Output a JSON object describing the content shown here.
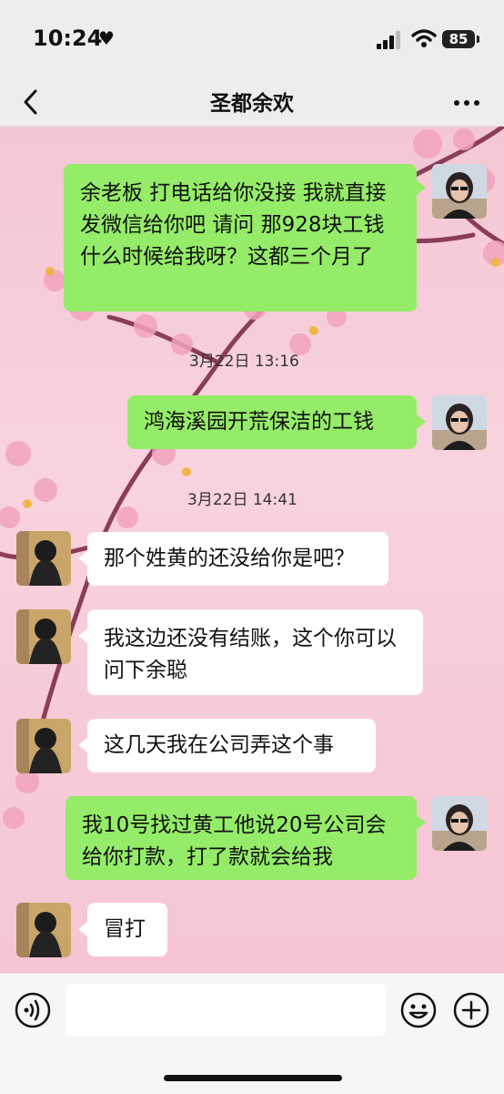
{
  "status_bar": {
    "time": "10:24",
    "battery": "85"
  },
  "chat": {
    "title": "圣都余欢"
  },
  "messages": [
    {
      "sender": "me",
      "text": "余老板 打电话给你没接 我就直接发微信给你吧 请问 那928块工钱什么时候给我呀？这都三个月了"
    },
    {
      "type": "timestamp",
      "text": "3月22日 13:16"
    },
    {
      "sender": "me",
      "text": "鸿海溪园开荒保洁的工钱"
    },
    {
      "type": "timestamp",
      "text": "3月22日 14:41"
    },
    {
      "sender": "them",
      "text": "那个姓黄的还没给你是吧？"
    },
    {
      "sender": "them",
      "text": "我这边还没有结账，这个你可以问下余聪"
    },
    {
      "sender": "them",
      "text": "这几天我在公司弄这个事"
    },
    {
      "sender": "me",
      "text": "我10号找过黄工他说20号公司会给你打款，打了款就会给我"
    },
    {
      "sender": "them",
      "text": "冒打"
    }
  ],
  "colors": {
    "my_bubble": "#95ec69",
    "their_bubble": "#ffffff",
    "background": "#f7c9d7"
  },
  "icons": [
    "back-icon",
    "more-icon",
    "voice-icon",
    "emoji-icon",
    "plus-icon",
    "heart-icon",
    "signal-icon",
    "wifi-icon"
  ]
}
